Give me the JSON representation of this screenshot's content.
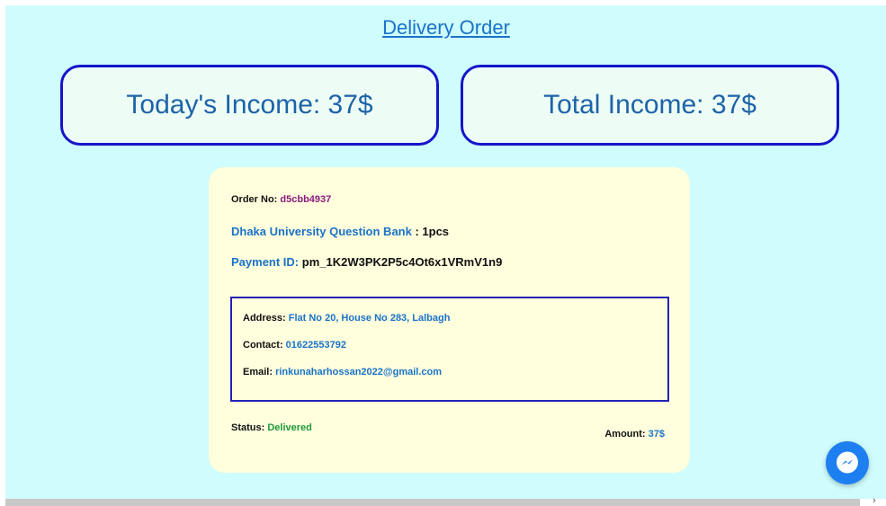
{
  "header": {
    "title": "Delivery Order"
  },
  "income": {
    "today": "Today's Income: 37$",
    "total": "Total Income: 37$"
  },
  "order": {
    "order_no_label": "Order No:",
    "order_no": "d5cbb4937",
    "product_name": "Dhaka University Question Bank",
    "product_qty": " : 1pcs",
    "payment_label": "Payment ID:",
    "payment_id": "pm_1K2W3PK2P5c4Ot6x1VRmV1n9",
    "address_label": "Address:",
    "address": "Flat No 20, House No 283, Lalbagh",
    "contact_label": "Contact:",
    "contact": "01622553792",
    "email_label": "Email:",
    "email": "rinkunaharhossan2022@gmail.com",
    "status_label": "Status:",
    "status": "Delivered",
    "amount_label": "Amount:",
    "amount": "37$"
  },
  "widgets": {
    "messenger_icon": "messenger-icon",
    "scroll_arrow_icon": "chevron-right-icon"
  },
  "colors": {
    "page_bg": "#cffcfc",
    "card_border": "#1515c9",
    "order_card_bg": "#fffedd",
    "link_blue": "#1a73c9",
    "status_green": "#1e9a3a",
    "order_no_purple": "#8a1a7e",
    "messenger_blue": "#1e80f0"
  }
}
